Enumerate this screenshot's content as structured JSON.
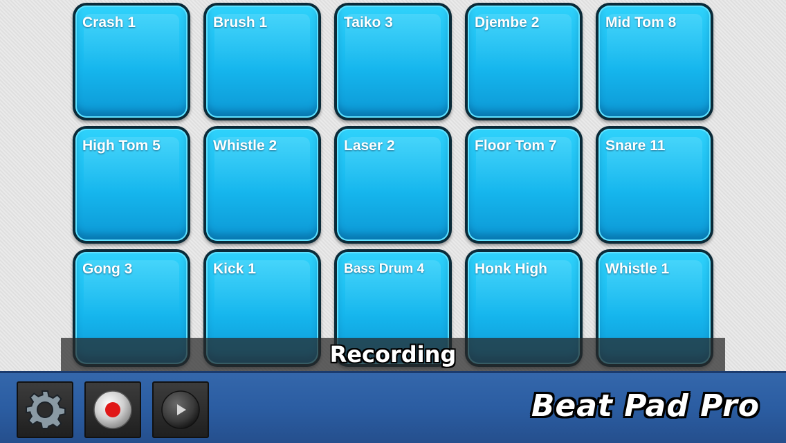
{
  "pads": [
    {
      "label": "Crash 1"
    },
    {
      "label": "Brush 1"
    },
    {
      "label": "Taiko 3"
    },
    {
      "label": "Djembe 2"
    },
    {
      "label": "Mid Tom 8"
    },
    {
      "label": "High Tom 5"
    },
    {
      "label": "Whistle 2"
    },
    {
      "label": "Laser 2"
    },
    {
      "label": "Floor Tom 7"
    },
    {
      "label": "Snare 11"
    },
    {
      "label": "Gong 3"
    },
    {
      "label": "Kick 1"
    },
    {
      "label": "Bass Drum 4"
    },
    {
      "label": "Honk High"
    },
    {
      "label": "Whistle 1"
    }
  ],
  "status": {
    "text": "Recording"
  },
  "toolbar": {
    "settings_icon": "gear-icon",
    "record_icon": "record-icon",
    "play_icon": "play-icon"
  },
  "app": {
    "logo_text": "Beat Pad Pro"
  },
  "colors": {
    "pad_fill": "#1ec3f5",
    "pad_border": "#0a2a38",
    "bar_blue": "#2b5da2",
    "record_red": "#e01818"
  }
}
